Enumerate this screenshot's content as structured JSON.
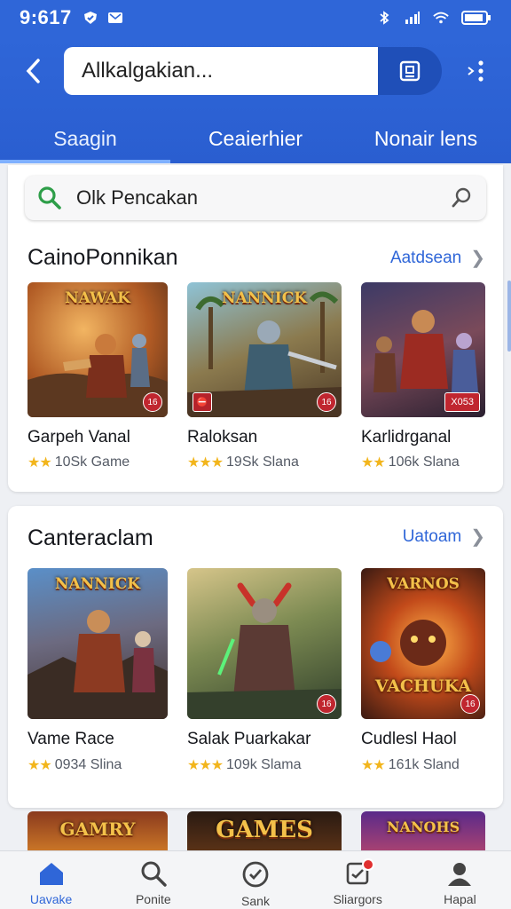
{
  "status_bar": {
    "time": "9:617"
  },
  "header": {
    "search_value": "Allkalgakian...",
    "tabs": [
      {
        "label": "Saagin",
        "active": true
      },
      {
        "label": "Ceaierhier",
        "active": false
      },
      {
        "label": "Nonair lens",
        "active": false
      }
    ]
  },
  "inner_search": {
    "value": "Olk Pencakan"
  },
  "section1": {
    "title": "CainoPonnikan",
    "link": "Aatdsean",
    "games": [
      {
        "logo": "NAWAK",
        "badge": "16",
        "name": "Garpeh Vanal",
        "meta": "10Sk Game",
        "stars": "★★"
      },
      {
        "logo": "NANNICK",
        "badge": "16",
        "name": "Raloksan",
        "meta": "19Sk Slana",
        "stars": "★★★",
        "left_badge": "⛔"
      },
      {
        "logo": "",
        "badge": "X053",
        "name": "Karlidrganal",
        "meta": "106k Slana",
        "stars": "★★"
      }
    ]
  },
  "section2": {
    "title": "Canteraclam",
    "link": "Uatoam",
    "games": [
      {
        "logo": "NANNICK",
        "badge": "",
        "name": "Vame Race",
        "meta": "0934 Slina",
        "stars": "★★"
      },
      {
        "logo": "",
        "badge": "16",
        "name": "Salak Puarkakar",
        "meta": "109k Slama",
        "stars": "★★★"
      },
      {
        "logo": "VARNOS",
        "logo2": "VACHUKA",
        "badge": "16",
        "name": "Cudlesl Haol",
        "meta": "161k Sland",
        "stars": "★★"
      }
    ]
  },
  "section3": {
    "thumbs": [
      {
        "logo": "GAMRY"
      },
      {
        "logo": "GAMES"
      },
      {
        "logo": "NANOHS"
      }
    ]
  },
  "bottom_nav": [
    {
      "label": "Uavake",
      "icon": "home-icon",
      "active": true
    },
    {
      "label": "Ponite",
      "icon": "search-icon",
      "active": false
    },
    {
      "label": "Sank",
      "icon": "check-circle-icon",
      "active": false
    },
    {
      "label": "Sliargors",
      "icon": "notifications-icon",
      "active": false
    },
    {
      "label": "Hapal",
      "icon": "profile-icon",
      "active": false
    }
  ],
  "colors": {
    "primary": "#2f66d8",
    "star": "#f2b51c",
    "badge": "#c0262f"
  }
}
